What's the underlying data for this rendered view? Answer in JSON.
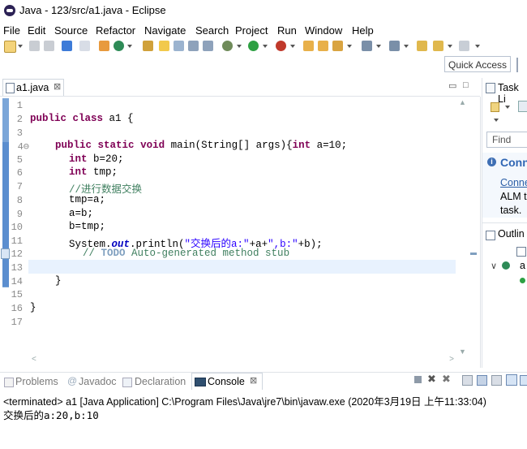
{
  "window": {
    "title": "Java - 123/src/a1.java - Eclipse"
  },
  "menu": [
    "File",
    "Edit",
    "Source",
    "Refactor",
    "Navigate",
    "Search",
    "Project",
    "Run",
    "Window",
    "Help"
  ],
  "quick_access": {
    "placeholder": "Quick Access"
  },
  "editor": {
    "tab_label": "a1.java",
    "tab_close": "⊠",
    "line_numbers": [
      "1",
      "2",
      "3",
      "4⊖",
      "5",
      "6",
      "7",
      "8",
      "9",
      "10",
      "11",
      "12",
      "13",
      "14",
      "15",
      "16",
      "17"
    ],
    "lines": {
      "l2_kw1": "public",
      "l2_kw2": "class",
      "l2_rest": " a1 {",
      "l4_kw1": "public",
      "l4_kw2": "static",
      "l4_kw3": "void",
      "l4_rest1": " main(String[] args){",
      "l4_kw4": "int",
      "l4_rest2": " a=10;",
      "l5_kw": "int",
      "l5_rest": " b=20;",
      "l6_kw": "int",
      "l6_rest": " tmp;",
      "l7_comment": "//进行数据交换",
      "l8": "tmp=a;",
      "l9": "a=b;",
      "l10": "b=tmp;",
      "l11_a": "System.",
      "l11_field": "out",
      "l11_b": ".println(",
      "l11_str1": "\"交换后的a:\"",
      "l11_c": "+a+",
      "l11_str2": "\",b:\"",
      "l11_d": "+b);",
      "l12_prefix": "// ",
      "l12_todo": "TODO",
      "l12_rest": " Auto-generated method stub",
      "l14": "}",
      "l16": "}"
    }
  },
  "right_pane": {
    "task_list_label": "Task Li",
    "find_placeholder": "Find",
    "connect_label": "Conn",
    "connect_link": "Conne",
    "alm_text": "ALM t",
    "task_text": "task.",
    "outline_label": "Outlin",
    "outline_class": "a"
  },
  "console": {
    "tabs": {
      "problems": "Problems",
      "javadoc": "Javadoc",
      "declaration": "Declaration",
      "console": "Console"
    },
    "status_line": "<terminated> a1 [Java Application] C:\\Program Files\\Java\\jre7\\bin\\javaw.exe (2020年3月19日 上午11:33:04)",
    "output_line": "交换后的a:20,b:10"
  },
  "colors": {
    "keyword": "#7f0055",
    "string": "#2a00ff",
    "comment": "#3f7f5f",
    "field": "#0000c0"
  }
}
